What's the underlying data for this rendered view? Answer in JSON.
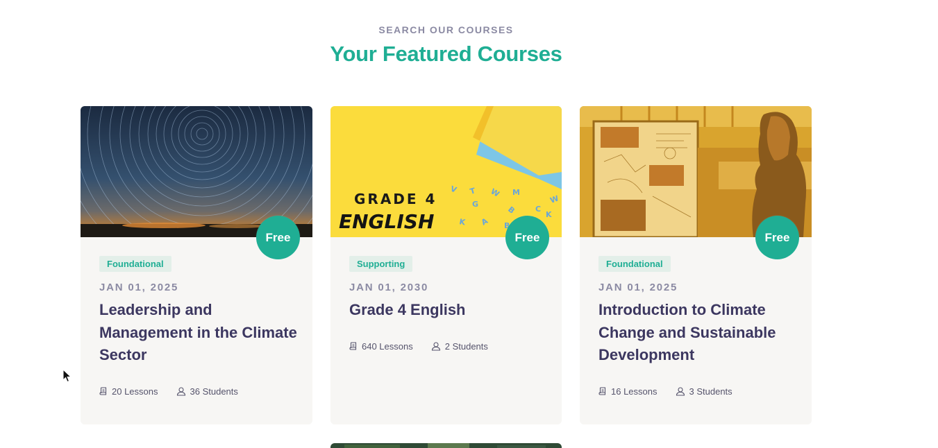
{
  "section": {
    "eyebrow": "SEARCH OUR COURSES",
    "heading": "Your Featured Courses"
  },
  "colors": {
    "accent": "#1fae94",
    "title": "#3c3760",
    "muted": "#8b8aa3",
    "card_bg": "#f7f6f4"
  },
  "courses": [
    {
      "image": "star-trails-night-sky",
      "price": "Free",
      "category": "Foundational",
      "date": "JAN 01, 2025",
      "title": "Leadership and Management in the Climate Sector",
      "lessons": "20 Lessons",
      "students": "36 Students"
    },
    {
      "image": "grade-4-english-yellow",
      "image_text_line1": "GRADE 4",
      "image_text_line2": "ENGLISH",
      "price": "Free",
      "category": "Supporting",
      "date": "JAN 01, 2030",
      "title": "Grade 4 English",
      "lessons": "640 Lessons",
      "students": "2 Students"
    },
    {
      "image": "woman-viewing-whiteboard-amber",
      "price": "Free",
      "category": "Foundational",
      "date": "JAN 01, 2025",
      "title": "Introduction to Climate Change and Sustainable Development",
      "lessons": "16 Lessons",
      "students": "3 Students"
    }
  ],
  "icons": {
    "lessons": "book-icon",
    "students": "user-icon",
    "pointer": "mouse-cursor-icon"
  }
}
